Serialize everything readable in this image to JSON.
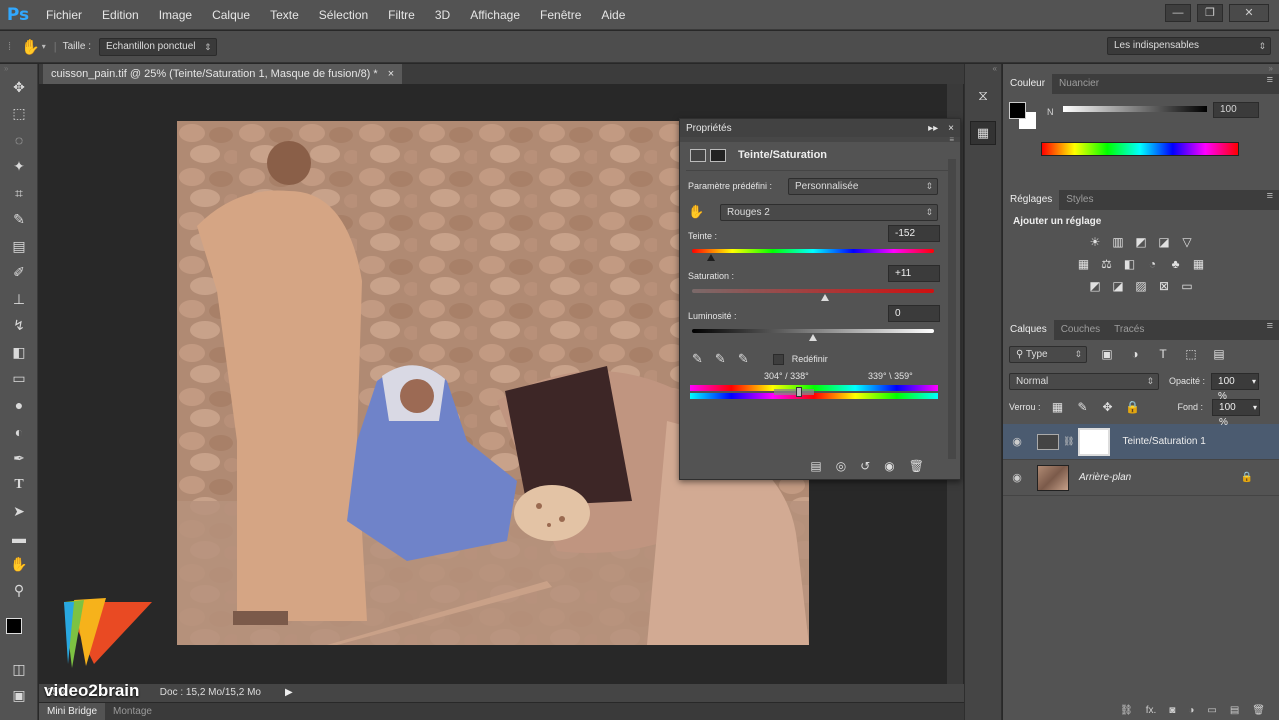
{
  "app": {
    "logo": "Ps",
    "menu": [
      "Fichier",
      "Edition",
      "Image",
      "Calque",
      "Texte",
      "Sélection",
      "Filtre",
      "3D",
      "Affichage",
      "Fenêtre",
      "Aide"
    ],
    "window_controls": {
      "minimize": "—",
      "restore": "❐",
      "close": "✕"
    }
  },
  "options_bar": {
    "size_label": "Taille :",
    "sample_select": "Echantillon ponctuel",
    "workspace_select": "Les indispensables"
  },
  "document": {
    "tab_title": "cuisson_pain.tif @ 25% (Teinte/Saturation 1, Masque de fusion/8) *",
    "tab_close": "×",
    "zoom_status": "25%",
    "doc_status": "Doc : 15,2 Mo/15,2 Mo",
    "bottom_tabs": [
      "Mini Bridge",
      "Montage"
    ]
  },
  "properties": {
    "panel_title": "Propriétés",
    "adjustment_title": "Teinte/Saturation",
    "preset_label": "Paramètre prédéfini :",
    "preset_value": "Personnalisée",
    "channel_value": "Rouges 2",
    "hue": {
      "label": "Teinte :",
      "value": "-152",
      "position": 0.08
    },
    "saturation": {
      "label": "Saturation :",
      "value": "+11",
      "position": 0.55
    },
    "lightness": {
      "label": "Luminosité :",
      "value": "0",
      "position": 0.5
    },
    "colorize_label": "Redéfinir",
    "range_left": "304° / 338°",
    "range_right": "339° \\ 359°"
  },
  "right_dock": {
    "color_tabs": [
      "Couleur",
      "Nuancier"
    ],
    "color_channel": "N",
    "color_value": "100",
    "adjust_tabs": [
      "Réglages",
      "Styles"
    ],
    "adjust_title": "Ajouter un réglage",
    "layers_tabs": [
      "Calques",
      "Couches",
      "Tracés"
    ],
    "filter_type": "Type",
    "blend_mode": "Normal",
    "opacity_label": "Opacité :",
    "opacity_value": "100 %",
    "lock_label": "Verrou :",
    "fill_label": "Fond :",
    "fill_value": "100 %",
    "layers": [
      {
        "name": "Teinte/Saturation 1",
        "selected": true
      },
      {
        "name": "Arrière-plan",
        "selected": false
      }
    ]
  },
  "watermark": "video2brain",
  "colors": {
    "accent": "#31a8ff",
    "panel": "#535353",
    "dark": "#282828",
    "selection": "#4b5b70"
  }
}
